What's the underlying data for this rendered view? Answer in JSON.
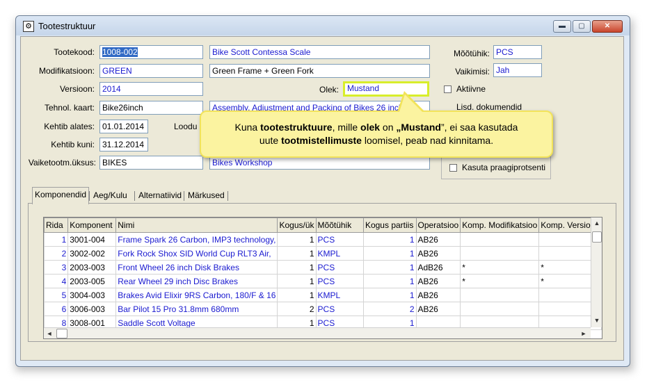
{
  "window": {
    "title": "Tootestruktuur"
  },
  "form": {
    "tootekood_label": "Tootekood:",
    "tootekood_value": "1008-002",
    "name_value": "Bike Scott Contessa Scale",
    "modifikatsioon_label": "Modifikatsioon:",
    "modifikatsioon_value": "GREEN",
    "modifikatsioon_desc": "Green Frame + Green Fork",
    "versioon_label": "Versioon:",
    "versioon_value": "2014",
    "olek_label": "Olek:",
    "olek_value": "Mustand",
    "tehnol_label": "Tehnol. kaart:",
    "tehnol_value": "Bike26inch",
    "tehnol_desc": "Assembly, Adjustment and Packing of Bikes 26 inch",
    "kehtib_alates_label": "Kehtib alates:",
    "kehtib_alates_value": "01.01.2014",
    "loodud_label": "Loodu",
    "kehtib_kuni_label": "Kehtib kuni:",
    "kehtib_kuni_value": "31.12.2014",
    "vaiketootm_label": "Vaiketootm.üksus:",
    "vaiketootm_value": "BIKES",
    "vaiketootm_desc": "Bikes Workshop",
    "mootuhik_label": "Mõõtühik:",
    "mootuhik_value": "PCS",
    "vaikimisi_label": "Vaikimisi:",
    "vaikimisi_value": "Jah",
    "aktiivne_label": "Aktiivne",
    "dokumendid_label": "Lisd. dokumendid",
    "kasuta_label": "Kasuta praagiprotsenti"
  },
  "callout": {
    "t1": "Kuna ",
    "b1": "tootestruktuure",
    "t2": ", mille ",
    "b2": "olek",
    "t3": " on ",
    "b3": "„Mustand",
    "t4": "”, ei saa kasutada",
    "t5": "uute ",
    "b4": "tootmistellimuste",
    "t6": " loomisel, peab nad kinnitama."
  },
  "tabs": [
    "Komponendid",
    "Aeg/Kulu",
    "Alternatiivid",
    "Märkused"
  ],
  "table": {
    "headers": [
      "Rida",
      "Komponent",
      "Nimi",
      "Kogus/ük",
      "Mõõtühik",
      "Kogus partiis",
      "Operatsioo",
      "Komp. Modifikatsioo",
      "Komp. Versioon"
    ],
    "rows": [
      [
        "1",
        "3001-004",
        "Frame Spark 26 Carbon, IMP3 technology,",
        "1",
        "PCS",
        "1",
        "AB26",
        "",
        ""
      ],
      [
        "2",
        "3002-002",
        "Fork Rock Shox SID World Cup RLT3 Air,",
        "1",
        "KMPL",
        "1",
        "AB26",
        "",
        ""
      ],
      [
        "3",
        "2003-003",
        "Front Wheel 26 inch Disk Brakes",
        "1",
        "PCS",
        "1",
        "AdB26",
        "*",
        "*"
      ],
      [
        "4",
        "2003-005",
        "Rear Wheel 29 inch Disc Brakes",
        "1",
        "PCS",
        "1",
        "AB26",
        "*",
        "*"
      ],
      [
        "5",
        "3004-003",
        "Brakes Avid Elixir 9RS Carbon, 180/F & 16",
        "1",
        "KMPL",
        "1",
        "AB26",
        "",
        ""
      ],
      [
        "6",
        "3006-003",
        "Bar Pilot 15 Pro 31.8mm 680mm",
        "2",
        "PCS",
        "2",
        "AB26",
        "",
        ""
      ],
      [
        "8",
        "3008-001",
        "Saddle Scott Voltage",
        "1",
        "PCS",
        "1",
        "",
        "",
        ""
      ]
    ]
  }
}
